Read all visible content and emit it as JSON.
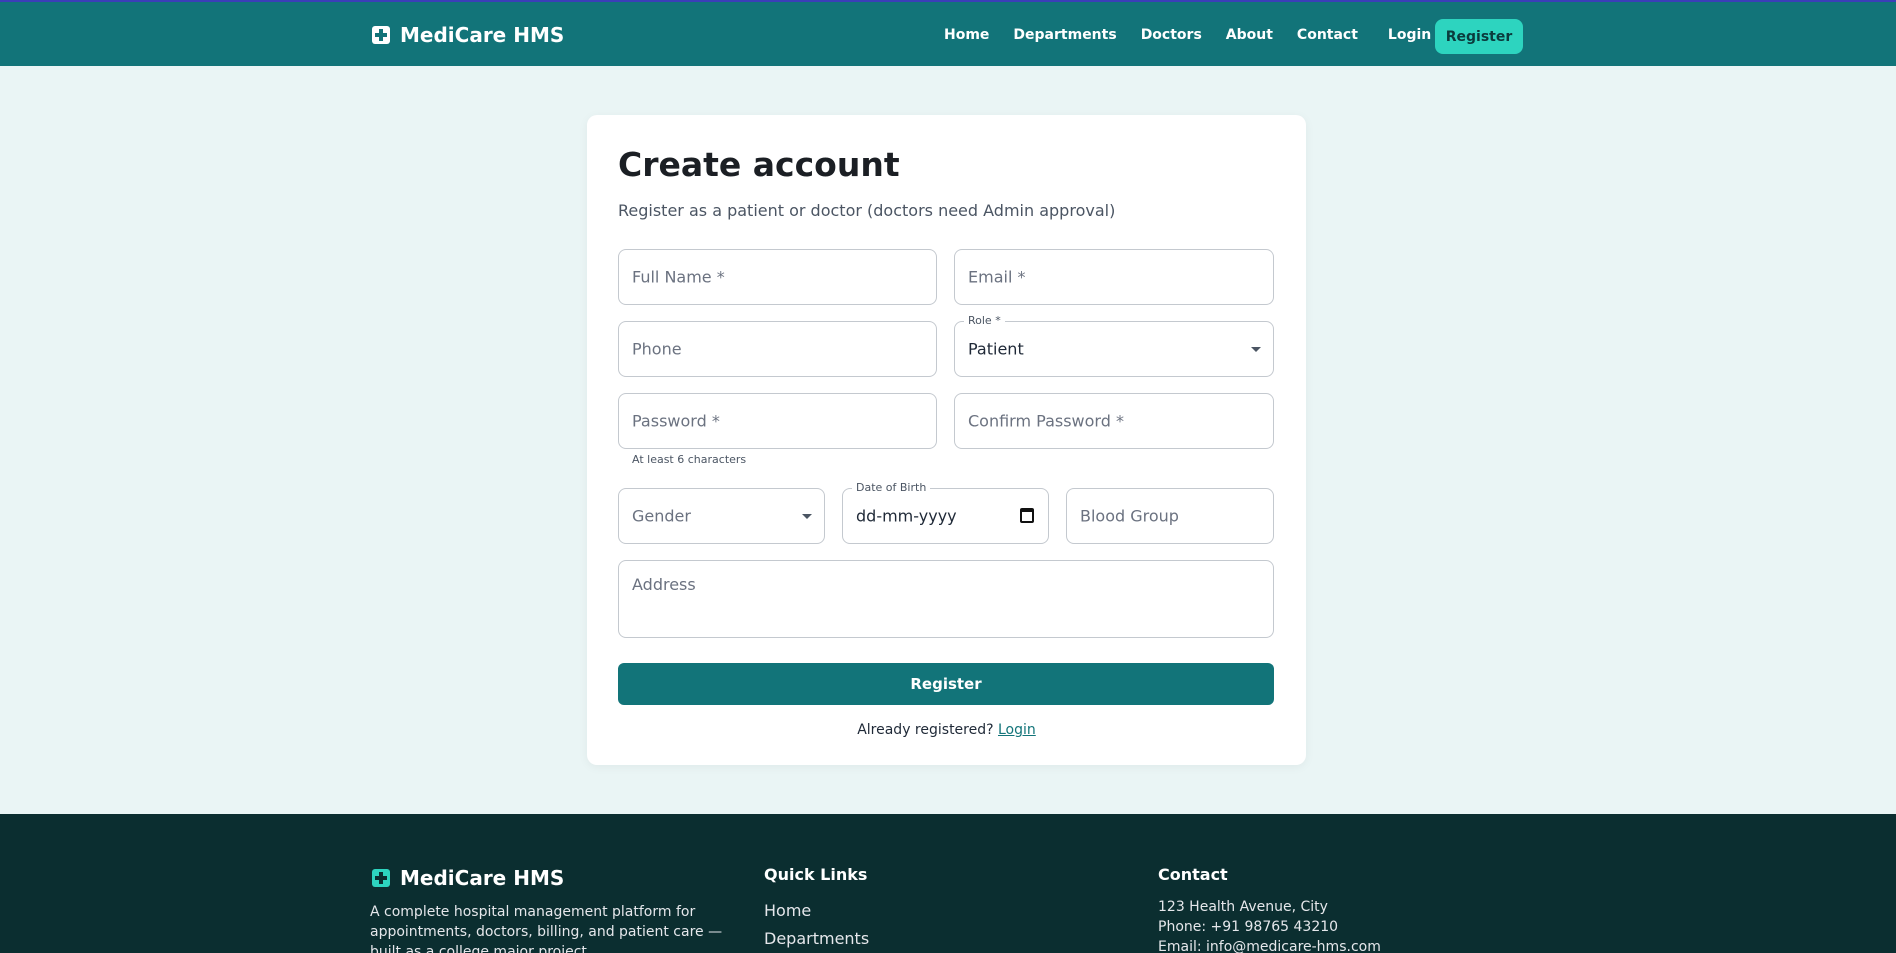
{
  "nav": {
    "brand": "MediCare HMS",
    "links": [
      "Home",
      "Departments",
      "Doctors",
      "About",
      "Contact"
    ],
    "login": "Login",
    "register": "Register"
  },
  "form": {
    "title": "Create account",
    "subtitle": "Register as a patient or doctor (doctors need Admin approval)",
    "full_name_placeholder": "Full Name *",
    "email_placeholder": "Email *",
    "phone_placeholder": "Phone",
    "role_label": "Role *",
    "role_value": "Patient",
    "password_placeholder": "Password *",
    "confirm_password_placeholder": "Confirm Password *",
    "password_helper": "At least 6 characters",
    "gender_placeholder": "Gender",
    "dob_label": "Date of Birth",
    "dob_value": "dd-mm-yyyy",
    "blood_group_placeholder": "Blood Group",
    "address_placeholder": "Address",
    "submit": "Register",
    "already_text": "Already registered?",
    "login_link": "Login"
  },
  "footer": {
    "brand": "MediCare HMS",
    "description": "A complete hospital management platform for appointments, doctors, billing, and patient care — built as a college major project.",
    "quick_links_title": "Quick Links",
    "quick_links": [
      "Home",
      "Departments"
    ],
    "contact_title": "Contact",
    "address": "123 Health Avenue, City",
    "phone": "Phone: +91 98765 43210",
    "email": "Email: info@medicare-hms.com"
  },
  "colors": {
    "primary": "#127479",
    "accent": "#2dd4bf",
    "footer_bg": "#0b2e30",
    "page_bg": "#eaf5f5"
  }
}
